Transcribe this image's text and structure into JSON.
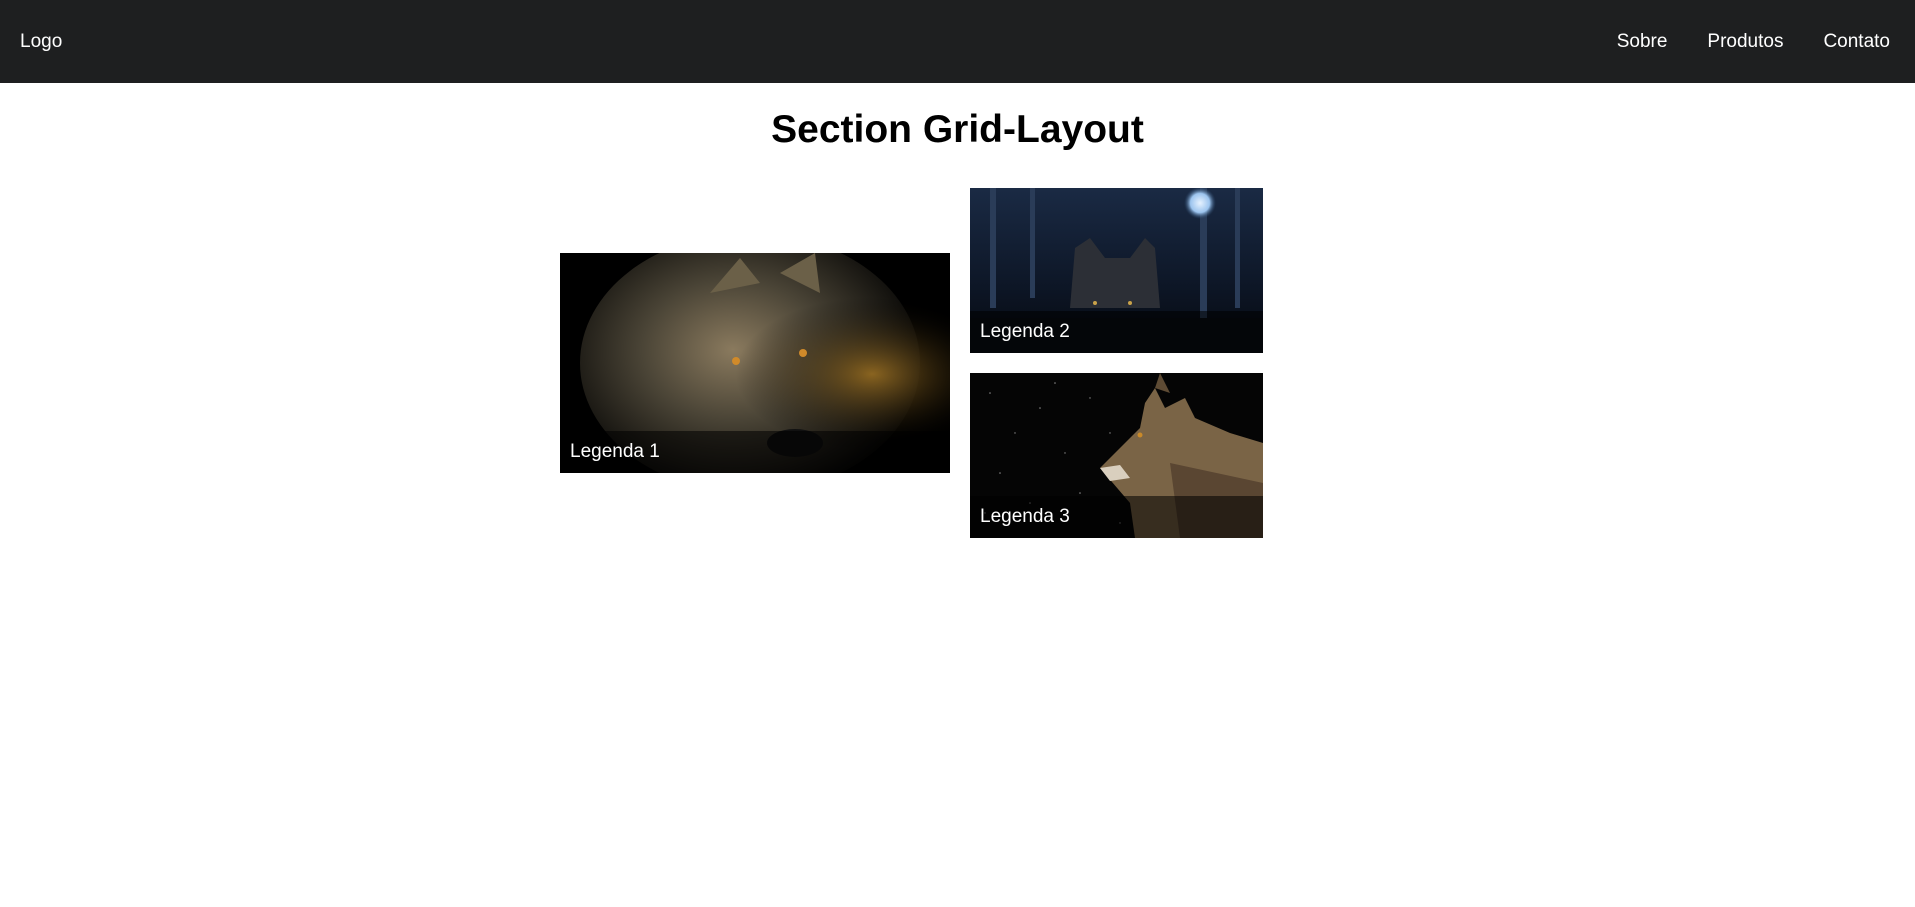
{
  "navbar": {
    "logo": "Logo",
    "links": [
      "Sobre",
      "Produtos",
      "Contato"
    ]
  },
  "section": {
    "title": "Section Grid-Layout"
  },
  "gallery": {
    "items": [
      {
        "caption": "Legenda 1",
        "image": "wolf-closeup-golden"
      },
      {
        "caption": "Legenda 2",
        "image": "wolf-night-forest-moon"
      },
      {
        "caption": "Legenda 3",
        "image": "wolf-profile-starry"
      }
    ]
  },
  "colors": {
    "navbar_bg": "#1e1f20",
    "text_light": "#ffffff",
    "text_dark": "#000000"
  }
}
